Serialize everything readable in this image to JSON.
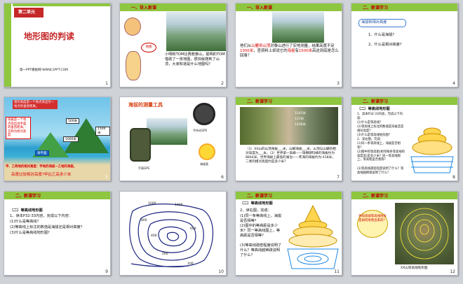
{
  "slides": [
    {
      "num": "1",
      "unit": "第二单元",
      "title": "地形图的判读",
      "sub": "第一PPT模板网-WWW.1PPT.COM"
    },
    {
      "num": "2",
      "header": "一、导入新课",
      "text": "小明和TOM比赛爬泰山，聪明的TOM借助了一张地图，很快就爬到了山顶，大家知道是什么地图吗？",
      "bubble": "地图"
    },
    {
      "num": "3",
      "header": "一、导入新课",
      "text1": "他们从",
      "hl1": "山麓到山顶",
      "text2": "对泰山进行了实地测量，结果高度不足",
      "hl2": "1300米",
      "text3": "，查资料上却说它的",
      "hl3": "海拔",
      "text4": "有",
      "hl4": "1500米",
      "text5": "高这到底是怎么回事？"
    },
    {
      "num": "4",
      "header": "二、新课学习",
      "box": "海拔和相对高度",
      "q1": "1、什么是海拔?",
      "q2": "2、什么是相对高度?"
    },
    {
      "num": "5",
      "bubble1": "相对高度是一个地点高出另一地点的垂直距离。",
      "bubble2": "海拔是一个地点高出海平面的垂直距离。又称为绝对高度",
      "v500": "500米",
      "v1500": "1500米",
      "v1000": "1000米",
      "sea": "海平面",
      "note1": "甲、乙两地的相对高度：甲地的海拔—乙地的海拔。",
      "note2": "高度比较相对高度?甲比乙高多少米"
    },
    {
      "num": "6",
      "title": "海拔的测量工具",
      "lbl1": "手表GPS",
      "lbl2": "手持式GPS",
      "lbl3": "海拔表"
    },
    {
      "num": "7",
      "header": "二、新课学习",
      "text": "（1）XX山的山顶海拔___米，山脚海拔___米，山顶与山脚的相对高度为___米。（2）世界第一高峰——珠穆朗玛峰的海拔约为8844米，世界海拔上最低的湖泊——死海的海拔约为-418米，二者的相对高度约是多少米？",
      "a1": "1545米",
      "a2": "137米",
      "a3": "1408米"
    },
    {
      "num": "8",
      "header": "二、新课学习",
      "sec": "（二）等高线地形图",
      "t1": "1、读本P32-33内容，完成以下内容：",
      "t2": "(1)什么是等高线？",
      "t3": "(2)等高线上标注的数值是海拔还是相对高度？",
      "t4": "(3)什么是等高线地形图？",
      "t5": "2、读右图，完成：",
      "t6": "(1)同一条等高线上，海拔是否相等？",
      "t7": "(2)图中的等高距(相邻两条等高线的高度差)是多少米？同一等高线图上，等高距是否相等？",
      "t8": "(3)等高线疏密程度说明了什么？等高线越稀疏说明了什么？"
    },
    {
      "num": "9",
      "header": "二、新课学习",
      "sec": "（二）等高线地形图",
      "t1": "1、读本P32-33内容，完成以下内容：",
      "t2": "(1)什么是等高线？",
      "t3": "(2)等高线上标注的数值是海拔还是相对高度？",
      "t4": "(3)什么是等高线地形图？"
    },
    {
      "num": "10",
      "contours": [
        "1000",
        "1000",
        "800",
        "600",
        "400",
        "200",
        "100"
      ]
    },
    {
      "num": "11",
      "header": "二、新课学习",
      "sec": "（二）等高线地形图",
      "t1": "2、读右图，完成：",
      "t2": "(1)同一条等高线上，海拔是否相等？",
      "t3": "(2)图中的等高距是多少米？同一等高线图上，等高距是否相等？",
      "t4": "(3)等高线疏密程度说明了什么？等高线越稀疏说明了什么？"
    },
    {
      "num": "12",
      "header": "二、新课学习",
      "bubble": "你知道坡等高线地形是如何绘制出来的？",
      "caption": "XX山等高线地形图"
    }
  ]
}
